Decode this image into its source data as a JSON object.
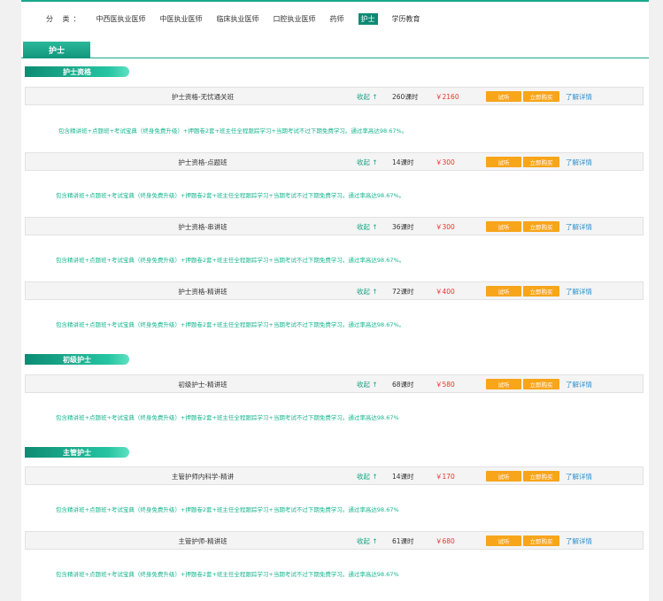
{
  "categories": {
    "label": "分  类：",
    "items": [
      "中西医执业医师",
      "中医执业医师",
      "临床执业医师",
      "口腔执业医师",
      "药师",
      "护士",
      "学历教育"
    ],
    "active": "护士"
  },
  "tab": {
    "label": "护士"
  },
  "sections": [
    {
      "title": "护士资格"
    },
    {
      "title": "初级护士"
    },
    {
      "title": "主管护士"
    }
  ],
  "common": {
    "collapse": "收起 ↑",
    "try": "试听",
    "buy": "立即购买",
    "detail": "了解详情",
    "desc": "包含精讲班+点题班+考试宝典（终身免费升级）+押题卷2套+班主任全程跟踪学习+当期考试不过下期免费学习。通过率高达98.67%"
  },
  "courses": [
    {
      "name": "护士资格-无忧通关班",
      "hours": "260课时",
      "price": "￥2160",
      "desc": "包含精讲班+点题班+考试宝典（终身免费升级）+押题卷2套+班主任全程跟踪学习+当期考试不过下期免费学习。通过率高达98.67%。"
    },
    {
      "name": "护士资格-点题班",
      "hours": "14课时",
      "price": "￥300",
      "desc": "包含精讲班+点题班+考试宝典（终身免费升级）+押题卷2套+班主任全程跟踪学习+当期考试不过下期免费学习。通过率高达98.67%。"
    },
    {
      "name": "护士资格-串讲班",
      "hours": "36课时",
      "price": "￥300",
      "desc": "包含精讲班+点题班+考试宝典（终身免费升级）+押题卷2套+班主任全程跟踪学习+当期考试不过下期免费学习。通过率高达98.67%。"
    },
    {
      "name": "护士资格-精讲班",
      "hours": "72课时",
      "price": "￥400",
      "desc": "包含精讲班+点题班+考试宝典（终身免费升级）+押题卷2套+班主任全程跟踪学习+当期考试不过下期免费学习。通过率高达98.67%。"
    },
    {
      "name": "初级护士-精讲班",
      "hours": "68课时",
      "price": "￥580",
      "desc": "包含精讲班+点题班+考试宝典（终身免费升级）+押题卷2套+班主任全程跟踪学习+当期考试不过下期免费学习。通过率高达98.67%"
    },
    {
      "name": "主管护师内科学-精讲",
      "hours": "14课时",
      "price": "￥170",
      "desc": "包含精讲班+点题班+考试宝典（终身免费升级）+押题卷2套+班主任全程跟踪学习+当期考试不过下期免费学习。通过率高达98.67%"
    },
    {
      "name": "主管护师-精讲班",
      "hours": "61课时",
      "price": "￥680",
      "desc": "包含精讲班+点题班+考试宝典（终身免费升级）+押题卷2套+班主任全程跟踪学习+当期考试不过下期免费学习。通过率高达98.67%"
    }
  ]
}
